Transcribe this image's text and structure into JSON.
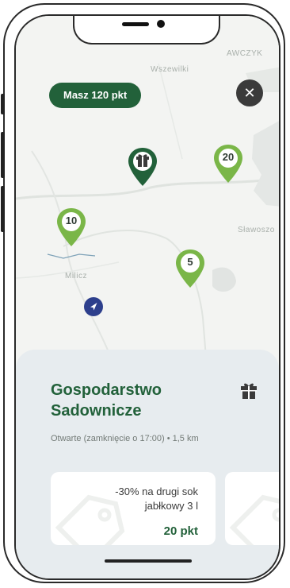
{
  "map": {
    "labels": {
      "top_place": "Wszewilki",
      "top_right": "AWCZYK",
      "right_place": "Sławoszo",
      "left_place": "Milicz"
    },
    "points_badge": "Masz 120 pkt",
    "pins": [
      {
        "label": "20",
        "color": "#7ab648"
      },
      {
        "label": "10",
        "color": "#7ab648"
      },
      {
        "label": "5",
        "color": "#7ab648"
      },
      {
        "label": "",
        "color": "#22613a",
        "icon": "gift-icon"
      }
    ]
  },
  "sheet": {
    "title": "Gospodarstwo Sadownicze",
    "status": "Otwarte (zamknięcie o 17:00)  •  1,5 km",
    "offer": {
      "text": "-30% na drugi sok jabłkowy 3 l",
      "points": "20 pkt"
    }
  },
  "colors": {
    "primary": "#22613a",
    "accent": "#7ab648"
  }
}
